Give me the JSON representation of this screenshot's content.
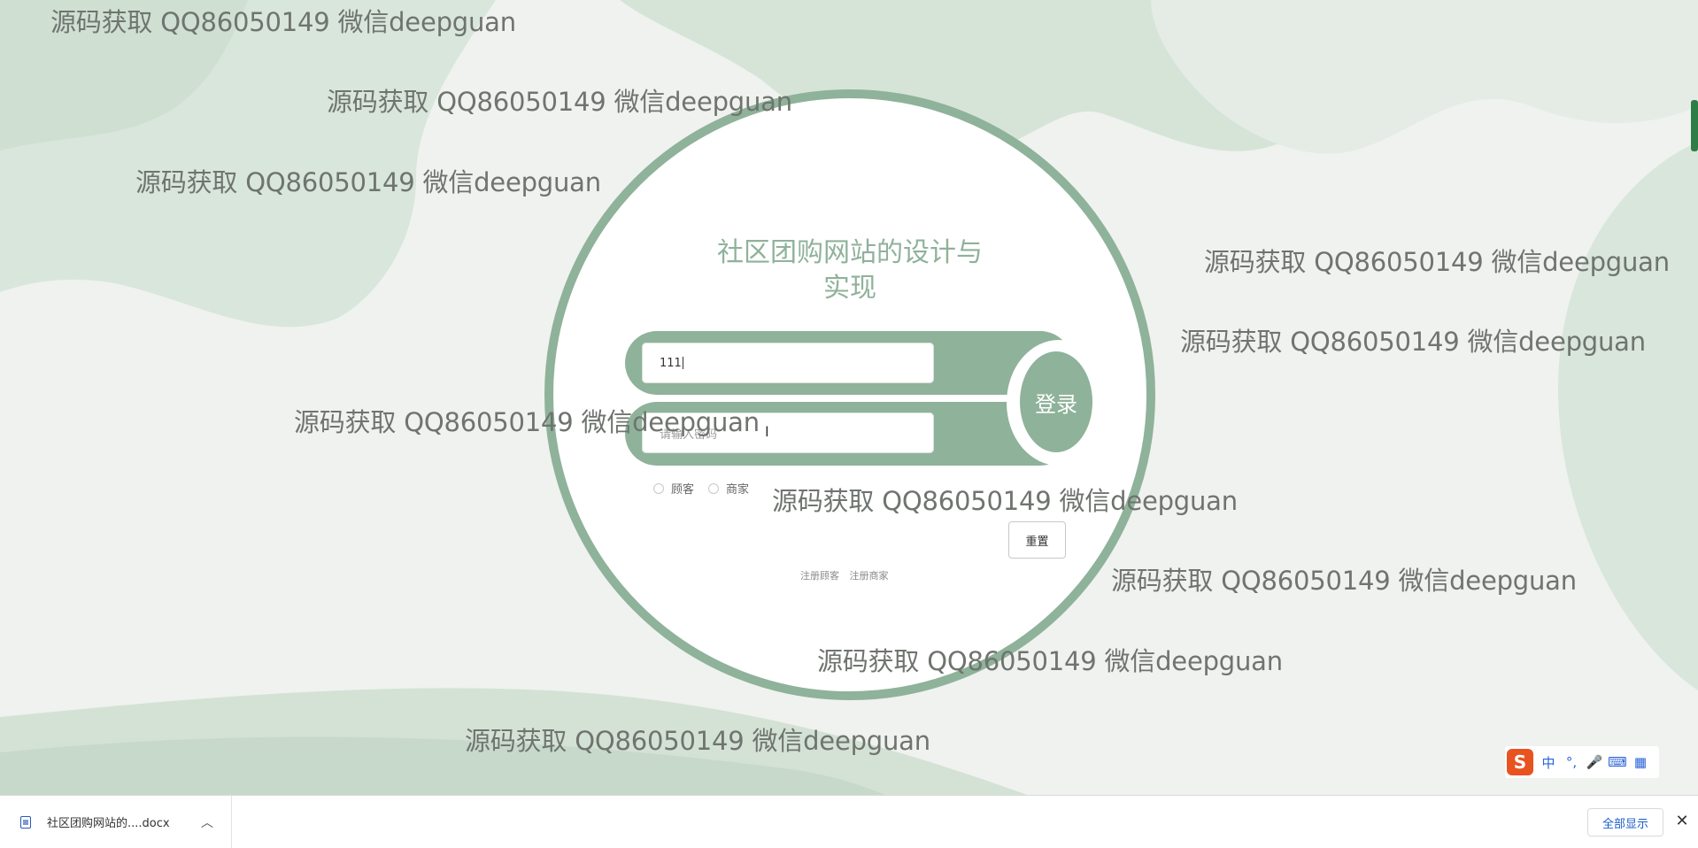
{
  "watermark_text": "源码获取 QQ86050149 微信deepguan",
  "login": {
    "title_line1": "社区团购网站的设计与",
    "title_line2": "实现",
    "username_value": "111",
    "password_placeholder": "请输入密码",
    "login_label": "登录",
    "roles": [
      "顾客",
      "商家"
    ],
    "reset_label": "重置",
    "links": [
      "注册顾客",
      "注册商家"
    ]
  },
  "ime": {
    "logo": "S",
    "items": [
      "中",
      "°,",
      "🎤",
      "⌨",
      "▦"
    ]
  },
  "download_bar": {
    "file_name": "社区团购网站的....docx",
    "show_all_label": "全部显示"
  },
  "colors": {
    "accent": "#8fb29a",
    "background": "#eff2ee",
    "watermark": "#6f746f"
  }
}
